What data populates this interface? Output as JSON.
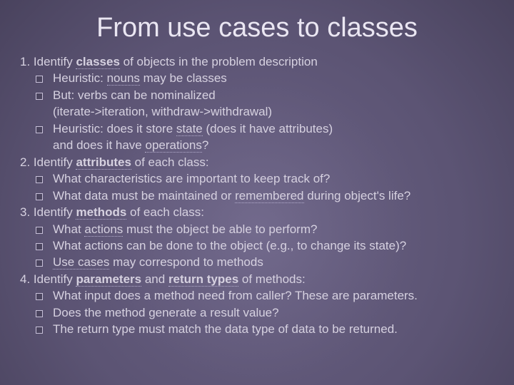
{
  "title": "From use cases to classes",
  "sections": [
    {
      "num": "1.",
      "text_before": " Identify ",
      "kw": "classes",
      "text_after": " of objects in the problem description",
      "bullets": [
        {
          "pre": "Heuristic: ",
          "kw": "nouns",
          "post": " may be classes"
        },
        {
          "pre": "But: verbs can be nominalized",
          "cont": "(iterate->iteration, withdraw->withdrawal)"
        },
        {
          "pre": "Heuristic: does it store ",
          "kw": "state",
          "post": " (does it have attributes)",
          "cont2_pre": "and does it have ",
          "cont2_kw": "operations",
          "cont2_post": "?"
        }
      ]
    },
    {
      "num": "2.",
      "text_before": " Identify ",
      "kw": "attributes",
      "text_after": " of each class:",
      "bullets": [
        {
          "pre": "What characteristics are important to keep track of?"
        },
        {
          "pre": "What data must be maintained or ",
          "kw": "remembered",
          "post": " during object's life?"
        }
      ]
    },
    {
      "num": "3.",
      "text_before": " Identify ",
      "kw": "methods",
      "text_after": " of each class:",
      "bullets": [
        {
          "pre": "What ",
          "kw": "actions",
          "post": " must the object be able to perform?"
        },
        {
          "pre": "What actions can be done to the object (e.g., to change its state)?"
        },
        {
          "kw": "Use cases",
          "post": " may correspond to methods"
        }
      ]
    },
    {
      "num": "4.",
      "text_before": " Identify ",
      "kw": "parameters",
      "mid": " and ",
      "kw2": "return types",
      "text_after": " of methods:",
      "bullets": [
        {
          "pre": "What input does a method need from caller? These are parameters."
        },
        {
          "pre": "Does the method generate a result value?"
        },
        {
          "pre": "The return type must match the data type of data to be returned."
        }
      ]
    }
  ]
}
